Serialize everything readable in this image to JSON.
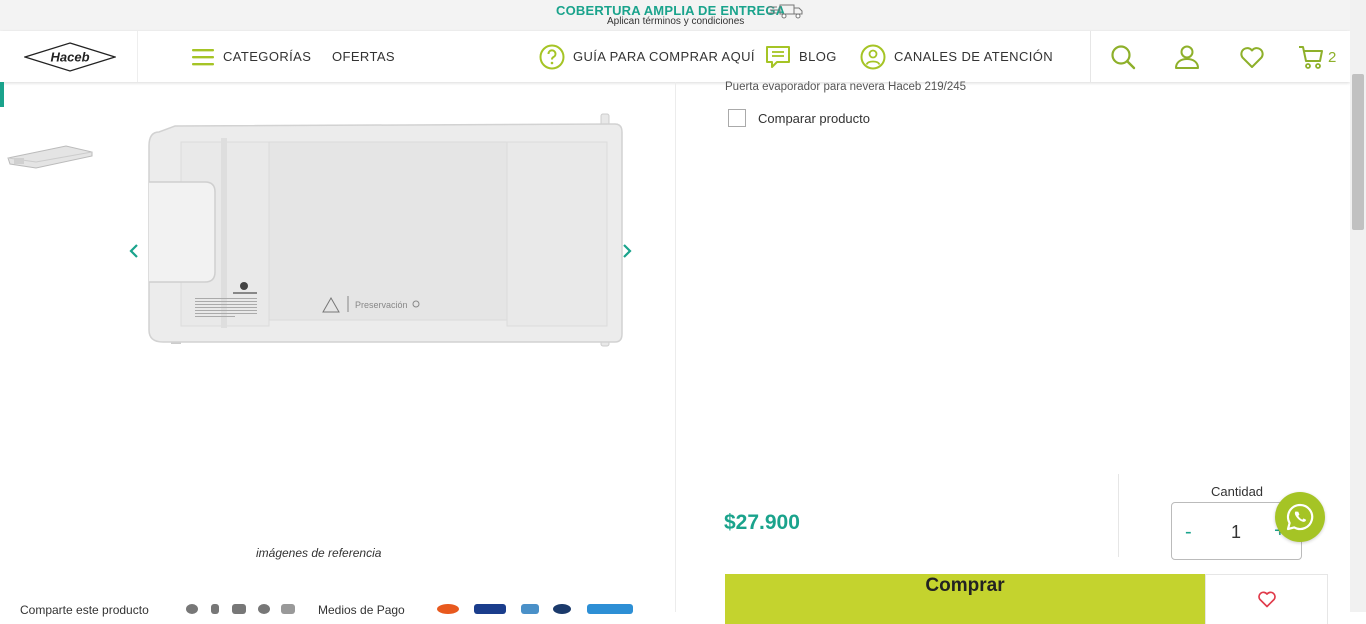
{
  "topbar": {
    "promo": "COBERTURA AMPLIA DE ENTREGA",
    "terms": "Aplican términos y condiciones"
  },
  "header": {
    "logo_text": "Haceb",
    "nav": {
      "categories": "CATEGORÍAS",
      "offers": "OFERTAS",
      "guide": "GUÍA PARA COMPRAR AQUÍ",
      "blog": "BLOG",
      "channels": "CANALES DE ATENCIÓN"
    },
    "cart_count": "2",
    "icons": [
      "search-icon",
      "user-icon",
      "heart-icon",
      "cart-icon"
    ]
  },
  "gallery": {
    "caption": "imágenes de referencia",
    "image_label": "Preservación"
  },
  "footer_strip": {
    "share": "Comparte este producto",
    "payment": "Medios de Pago"
  },
  "product": {
    "description": "Puerta evaporador para nevera Haceb 219/245",
    "compare_label": "Comparar producto",
    "price": "$27.900",
    "quantity_label": "Cantidad",
    "quantity_minus": "-",
    "quantity_value": "1",
    "quantity_plus": "+",
    "buy_label": "Comprar"
  },
  "colors": {
    "teal": "#1aa38c",
    "lime": "#c4d32e",
    "icon_green": "#8eb02a",
    "whatsapp": "#a5c425"
  }
}
